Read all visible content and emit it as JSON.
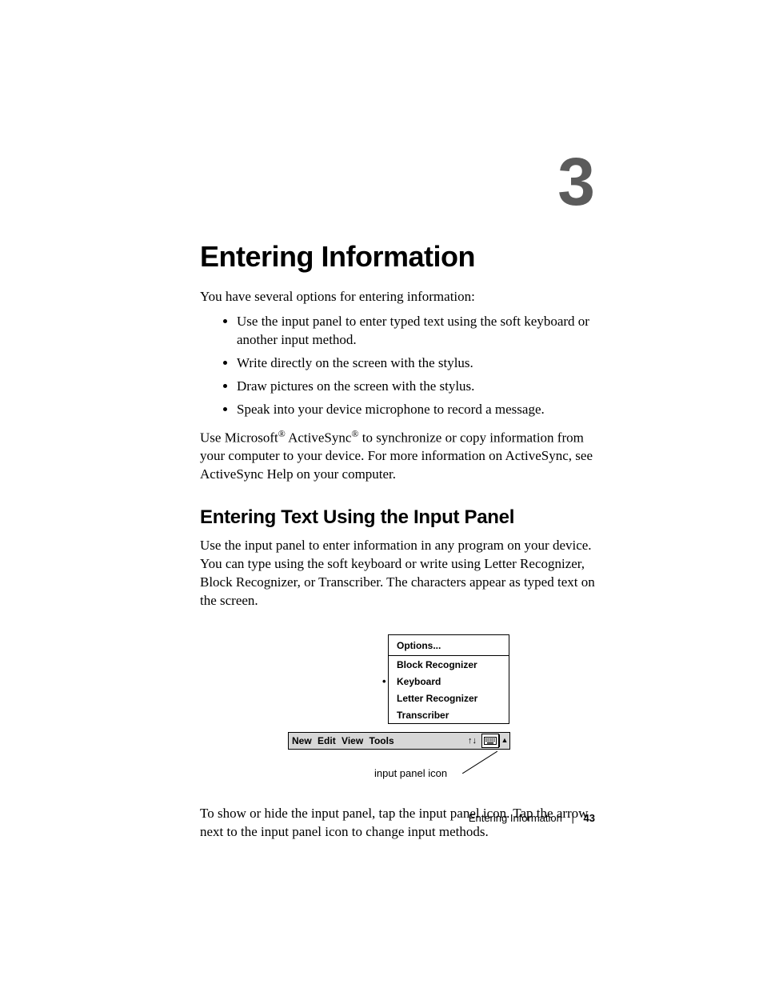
{
  "chapter": {
    "number": "3"
  },
  "title": "Entering Information",
  "intro": "You have several options for entering information:",
  "bullets": [
    "Use the input panel to enter typed text using the soft keyboard or another input method.",
    "Write directly on the screen with the stylus.",
    "Draw pictures on the screen with the stylus.",
    "Speak into your device microphone to record a message."
  ],
  "sync": {
    "pre": "Use Microsoft",
    "reg1": "®",
    "mid": " ActiveSync",
    "reg2": "®",
    "post": " to synchronize or copy information from your computer to your device. For more information on ActiveSync, see ActiveSync Help on your computer."
  },
  "section_title": "Entering Text Using the Input Panel",
  "section_body": "Use the input panel to enter information in any program on your device. You can type using the soft keyboard or write using Letter Recognizer, Block Recognizer, or Transcriber. The characters appear as typed text on the screen.",
  "popup": {
    "options_label": "Options...",
    "items": [
      {
        "label": "Block Recognizer",
        "selected": false
      },
      {
        "label": "Keyboard",
        "selected": true
      },
      {
        "label": "Letter Recognizer",
        "selected": false
      },
      {
        "label": "Transcriber",
        "selected": false
      }
    ]
  },
  "toolbar": {
    "menus": {
      "new": "New",
      "edit": "Edit",
      "view": "View",
      "tools": "Tools"
    },
    "updown_glyph": "↑↓",
    "arrow_glyph": "▲"
  },
  "callout": "input panel icon",
  "after_figure": "To show or hide the input panel, tap the input panel icon. Tap the arrow next to the input panel icon to change input methods.",
  "footer": {
    "section": "Entering Information",
    "sep": "|",
    "page": "43"
  }
}
